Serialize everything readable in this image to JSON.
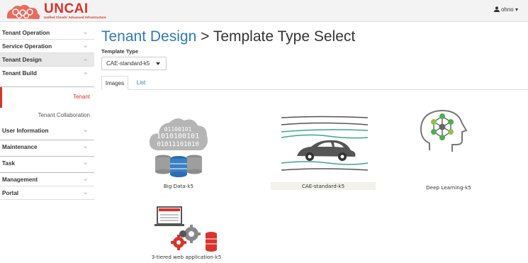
{
  "header": {
    "logo_text": "UNCAI",
    "logo_subtext": "Unified Clouds' Advanced Infrastructure",
    "user": "ohno"
  },
  "sidebar": {
    "items": [
      {
        "label": "Tenant Operation"
      },
      {
        "label": "Service Operation"
      },
      {
        "label": "Tenant Design"
      },
      {
        "label": "Tenant Build"
      },
      {
        "label": "Tenant"
      },
      {
        "label": "Tenant Collaboration"
      },
      {
        "label": "User Information"
      },
      {
        "label": "Maintenance"
      },
      {
        "label": "Task"
      },
      {
        "label": "Management"
      },
      {
        "label": "Portal"
      }
    ]
  },
  "main": {
    "title_prefix": "Tenant Design",
    "title_suffix": " > Template Type Select",
    "template_type_label": "Template Type",
    "template_type_value": "CAE-standard-k5",
    "tabs": [
      {
        "label": "Images"
      },
      {
        "label": "List"
      }
    ],
    "templates": [
      {
        "label": "Big Data-k5"
      },
      {
        "label": "CAE-standard-k5"
      },
      {
        "label": "Deep Learning-k5"
      },
      {
        "label": "3-tiered web application-k5"
      }
    ]
  },
  "colors": {
    "brand": "#d9342b",
    "accent": "#2e7ab8",
    "selected": "#e8e8e8"
  }
}
